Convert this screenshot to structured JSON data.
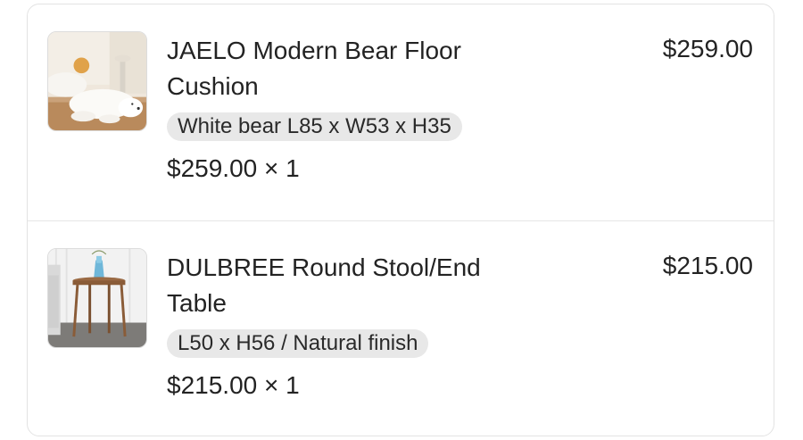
{
  "cart": {
    "items": [
      {
        "name": "JAELO Modern Bear Floor Cushion",
        "variant": "White bear L85 x W53 x H35",
        "unit_price_qty": "$259.00 × 1",
        "line_total": "$259.00",
        "image": "polar-bear-floor-cushion"
      },
      {
        "name": "DULBREE Round Stool/End Table",
        "variant": "L50 x H56 / Natural finish",
        "unit_price_qty": "$215.00 × 1",
        "line_total": "$215.00",
        "image": "round-wood-end-table"
      }
    ]
  }
}
